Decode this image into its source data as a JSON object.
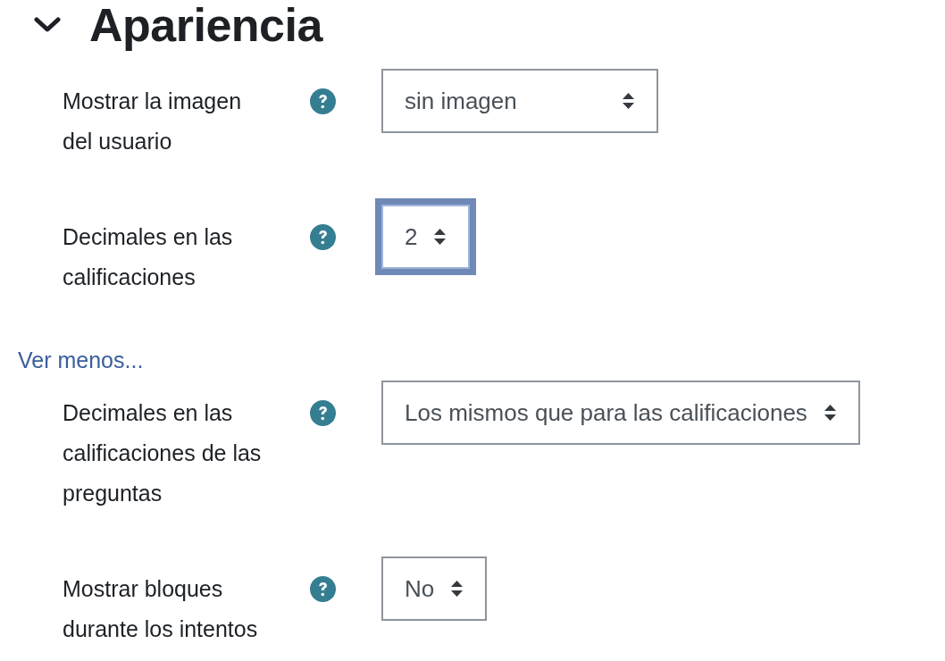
{
  "section": {
    "title": "Apariencia",
    "expanded": true
  },
  "fields": [
    {
      "label": "Mostrar la imagen del usuario",
      "value": "sin imagen",
      "focused": false
    },
    {
      "label": "Decimales en las calificaciones",
      "value": "2",
      "focused": true
    }
  ],
  "advanced_toggle": {
    "label": "Ver menos..."
  },
  "advanced_fields": [
    {
      "label": "Decimales en las calificaciones de las preguntas",
      "value": "Los mismos que para las calificaciones",
      "focused": false
    },
    {
      "label": "Mostrar bloques durante los intentos",
      "value": "No",
      "focused": false
    }
  ]
}
